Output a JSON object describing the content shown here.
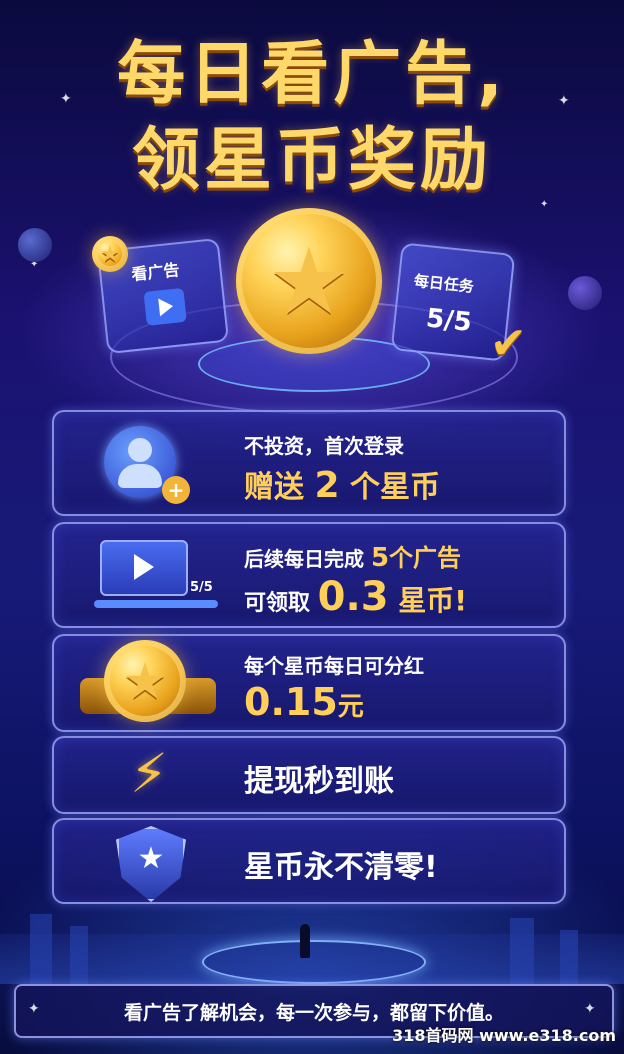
{
  "header": {
    "line1": "每日看广告,",
    "line2": "领星币奖励"
  },
  "badges": {
    "watch_ad": "看广告",
    "daily_task": "每日任务",
    "daily_progress": "5/5"
  },
  "cards": [
    {
      "line1": "不投资，首次登录",
      "line2a": "赠送 ",
      "line2b": "2",
      "line2c": " 个星币"
    },
    {
      "line1a": "后续每日完成 ",
      "line1b": "5",
      "line1c": "个广告",
      "line2a": "可领取 ",
      "line2b": "0.3",
      "line2c": " 星币!",
      "progress_label": "5/5"
    },
    {
      "line1": "每个星币每日可分红",
      "line2a": "0.15",
      "line2b": "元"
    },
    {
      "text": "提现秒到账"
    },
    {
      "text": "星币永不清零!"
    }
  ],
  "footer": {
    "text": "看广告了解机会，每一次参与，都留下价值。"
  },
  "watermark": {
    "text": "318首码网 www.e318.com"
  },
  "colors": {
    "gold": "#ffcf5a",
    "title_gold": "#ffd86a",
    "background": "#1a1170"
  },
  "icons": [
    "sparkle-icon",
    "star-coin-icon",
    "play-icon",
    "calendar-icon",
    "check-icon",
    "user-icon",
    "plus-icon",
    "lightning-icon",
    "shield-star-icon"
  ]
}
